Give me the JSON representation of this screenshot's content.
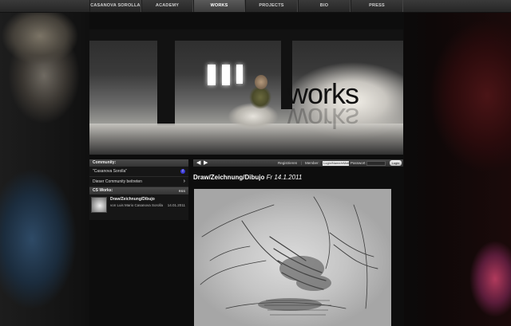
{
  "nav": {
    "items": [
      {
        "label": "CASANOVA SOROLLA",
        "active": false
      },
      {
        "label": "ACADEMY",
        "active": false
      },
      {
        "label": "WORKS",
        "active": true
      },
      {
        "label": "PROJECTS",
        "active": false
      },
      {
        "label": "BIO",
        "active": false
      },
      {
        "label": "PRESS",
        "active": false
      }
    ]
  },
  "banner": {
    "title": "works"
  },
  "sidebar": {
    "community_header": "Community:",
    "community_name": "\"Casanova Sorolla\"",
    "community_badge": "f",
    "join_label": "Dieser Community beitreten",
    "join_icon": "chevron-right-icon",
    "works_header": "CS Works:",
    "rss_label": "RSS",
    "post": {
      "title": "Draw/Zeichnung/Dibujo",
      "author": "von Luis Mario Casanova Sorolla",
      "date": "14.01.2011"
    }
  },
  "toolbar": {
    "prev_icon": "arrow-left-icon",
    "next_icon": "arrow-right-icon",
    "register_label": "Registrieren",
    "separator": "|",
    "member_label": "Member:",
    "username_placeholder": "Login/Name/eMail",
    "password_label": "Passwort",
    "login_label": "Login"
  },
  "post": {
    "title": "Draw/Zeichnung/Dibujo",
    "date": "Fr 14.1.2011"
  }
}
